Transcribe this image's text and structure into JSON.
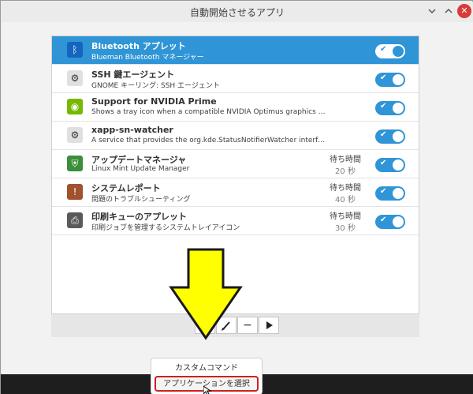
{
  "window": {
    "title": "自動開始させるアプリ",
    "minimize_icon": "minimize-icon",
    "maximize_icon": "maximize-icon",
    "close_icon": "close-icon"
  },
  "apps": [
    {
      "name": "Bluetooth アプレット",
      "desc": "Blueman Bluetooth マネージャー",
      "icon": "bluetooth-icon",
      "delay_label": "",
      "delay_value": "",
      "enabled": true,
      "selected": true
    },
    {
      "name": "SSH 鍵エージェント",
      "desc": "GNOME キーリング: SSH エージェント",
      "icon": "gears-icon",
      "delay_label": "",
      "delay_value": "",
      "enabled": true,
      "selected": false
    },
    {
      "name": "Support for NVIDIA Prime",
      "desc": "Shows a tray icon when a compatible NVIDIA Optimus graphics card is det...",
      "icon": "nvidia-icon",
      "delay_label": "",
      "delay_value": "",
      "enabled": true,
      "selected": false
    },
    {
      "name": "xapp-sn-watcher",
      "desc": "A service that provides the org.kde.StatusNotifierWatcher interface for XA...",
      "icon": "gears-icon",
      "delay_label": "",
      "delay_value": "",
      "enabled": true,
      "selected": false
    },
    {
      "name": "アップデートマネージャ",
      "desc": "Linux Mint Update Manager",
      "icon": "shield-icon",
      "delay_label": "待ち時間",
      "delay_value": "20 秒",
      "enabled": true,
      "selected": false
    },
    {
      "name": "システムレポート",
      "desc": "問題のトラブルシューティング",
      "icon": "report-icon",
      "delay_label": "待ち時間",
      "delay_value": "40 秒",
      "enabled": true,
      "selected": false
    },
    {
      "name": "印刷キューのアプレット",
      "desc": "印刷ジョブを管理するシステムトレイアイコン",
      "icon": "printer-icon",
      "delay_label": "待ち時間",
      "delay_value": "30 秒",
      "enabled": true,
      "selected": false
    }
  ],
  "toolbar": {
    "add_icon": "plus-icon",
    "edit_icon": "pencil-icon",
    "remove_icon": "minus-icon",
    "run_icon": "play-icon"
  },
  "menu": {
    "custom_command": "カスタムコマンド",
    "select_app": "アプリケーションを選択"
  },
  "colors": {
    "accent": "#2f95d6",
    "highlight_arrow": "#ffff00",
    "highlight_box": "#d02020"
  }
}
